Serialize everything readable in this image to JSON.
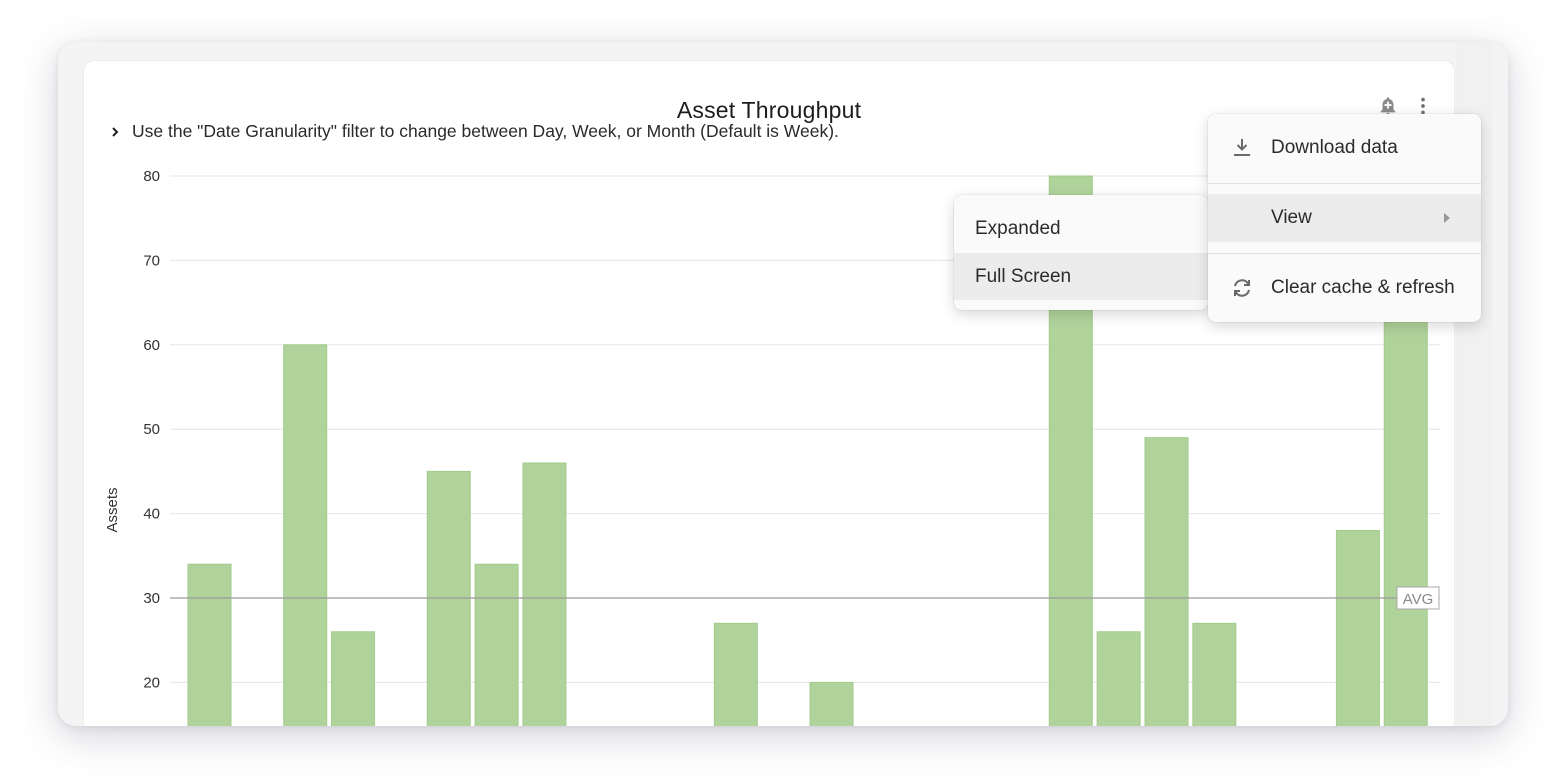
{
  "tile": {
    "title": "Asset Throughput",
    "note": "Use the \"Date Granularity\" filter to change between Day, Week, or Month (Default is Week).",
    "alert_icon": "bell-plus-icon",
    "menu_icon": "kebab-menu-icon",
    "expand_icon": "chevron-right-icon"
  },
  "menu": {
    "items": [
      {
        "label": "Download data",
        "icon": "download-icon"
      },
      {
        "label": "View",
        "icon": "submenu-arrow-icon"
      },
      {
        "label": "Clear cache & refresh",
        "icon": "refresh-icon"
      }
    ]
  },
  "submenu": {
    "items": [
      {
        "label": "Expanded"
      },
      {
        "label": "Full Screen"
      }
    ]
  },
  "colors": {
    "bar": "#b0d39c",
    "bar_stroke": "#a3cb8d",
    "grid": "#e6e6e6",
    "avg_line": "#9a9a9a"
  },
  "chart_data": {
    "type": "bar",
    "title": "Asset Throughput",
    "xlabel": "",
    "ylabel": "Assets",
    "ylim": [
      14,
      80
    ],
    "yticks": [
      20,
      30,
      40,
      50,
      60,
      70,
      80
    ],
    "grid": true,
    "reference_line": {
      "label": "AVG",
      "value": 30
    },
    "categories_count": 26,
    "values": [
      34,
      null,
      60,
      26,
      null,
      45,
      34,
      46,
      null,
      null,
      null,
      27,
      null,
      20,
      null,
      null,
      null,
      null,
      80,
      26,
      49,
      27,
      null,
      null,
      38,
      80
    ],
    "note": "Bars at indices 18 and 25 extend beyond the visible area (top hidden behind menus, value > 64). Null = bar not visible (below visible range or empty)."
  }
}
